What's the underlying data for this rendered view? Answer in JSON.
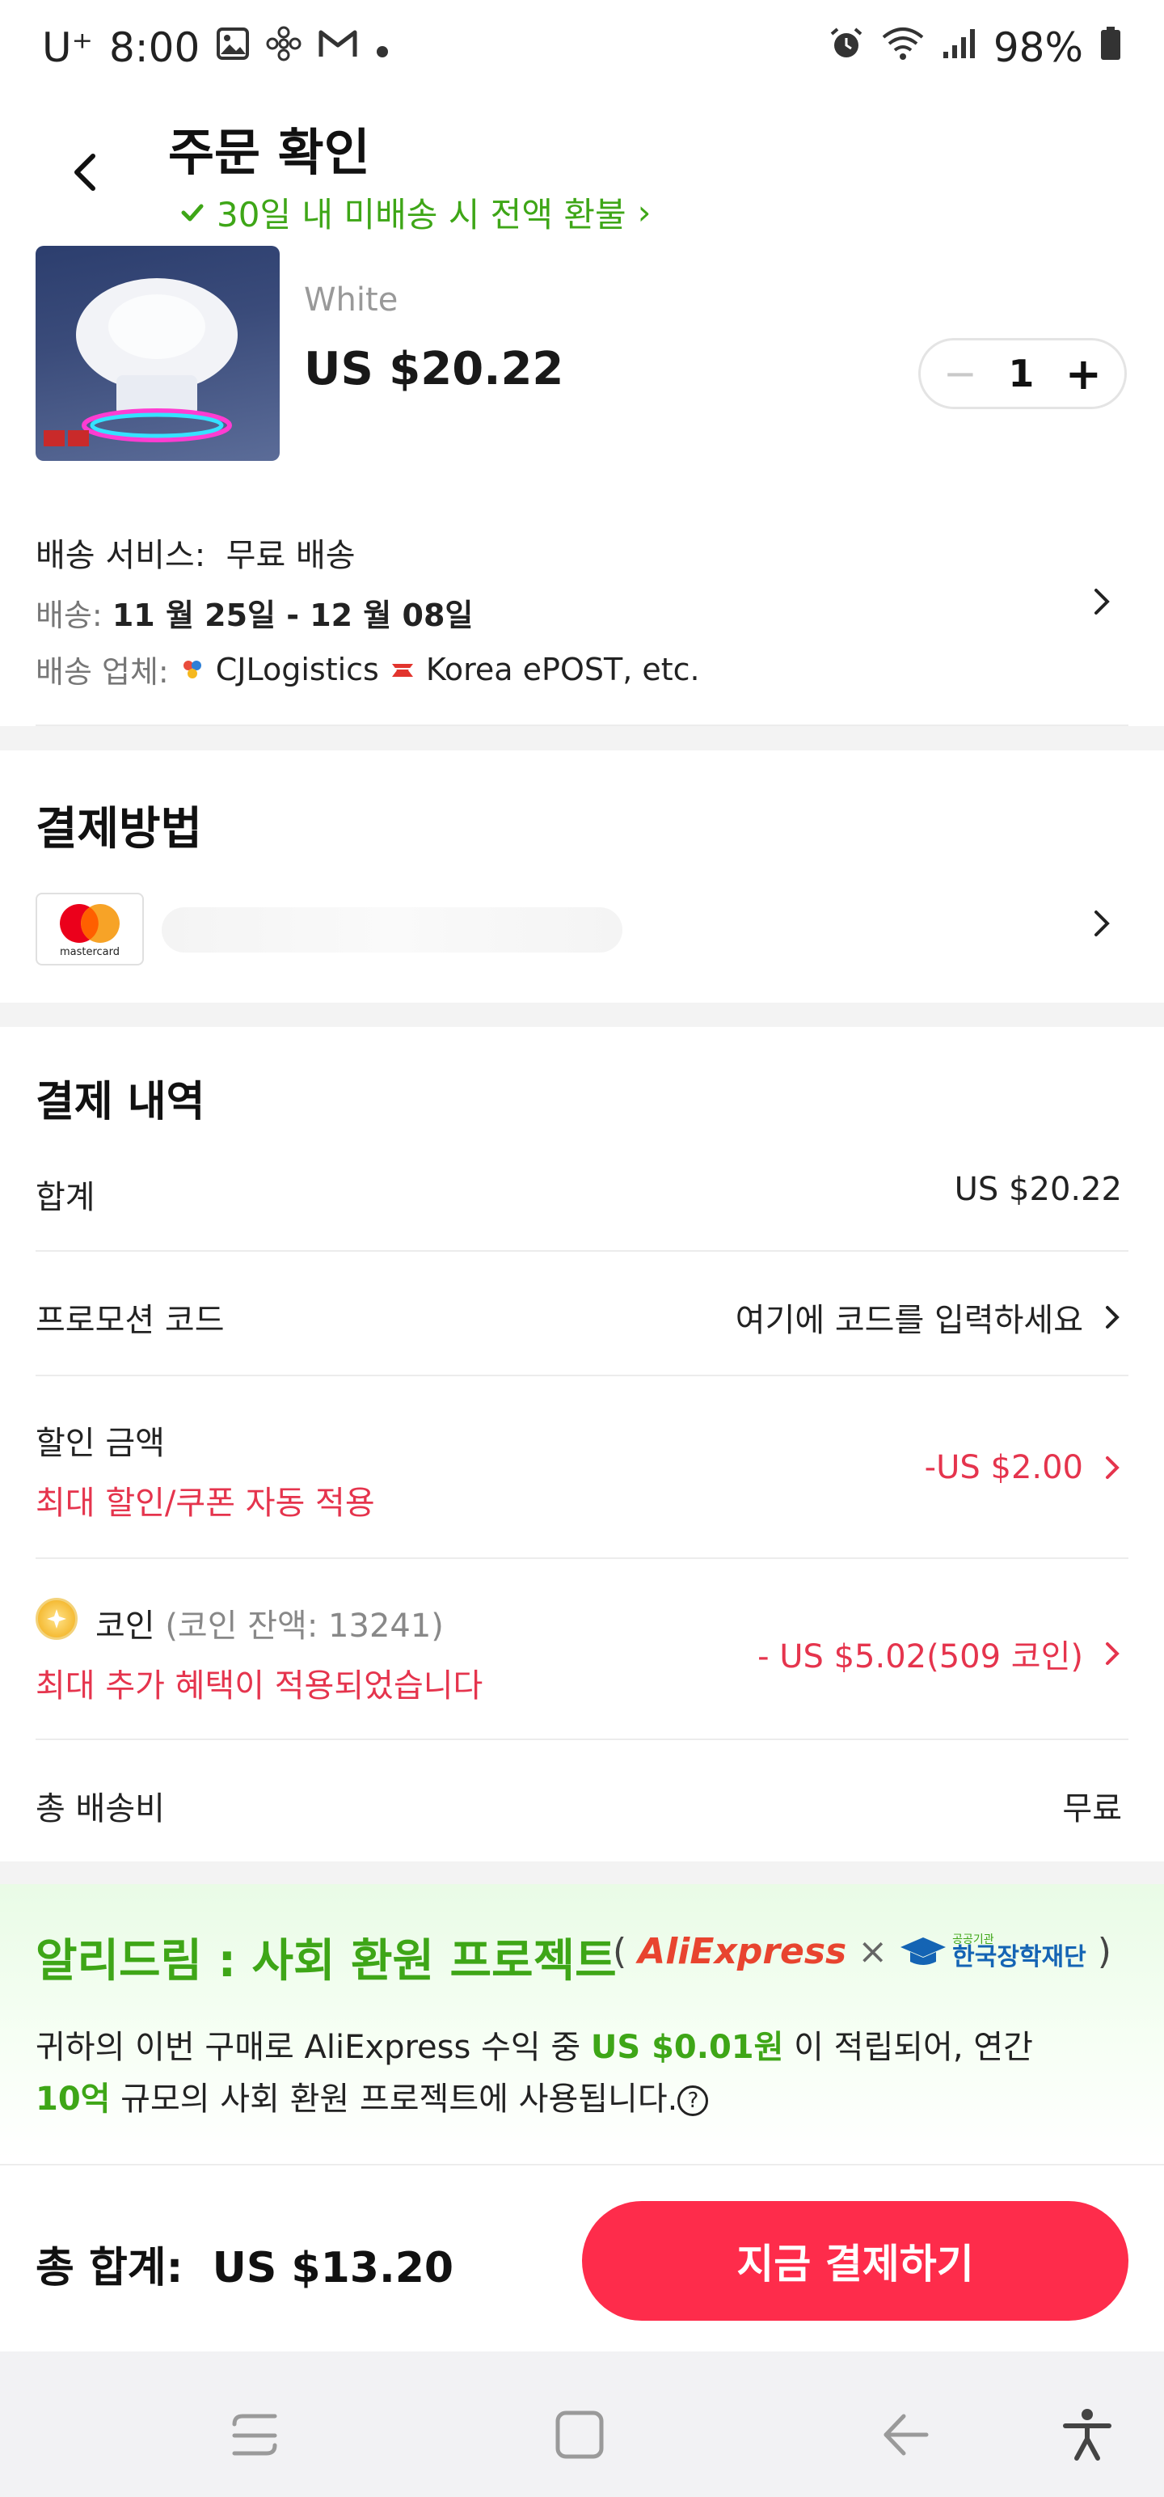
{
  "status_bar": {
    "carrier": "U⁺",
    "time": "8:00",
    "battery": "98%",
    "left_icons": [
      "gallery-icon",
      "fan-icon",
      "gmail-icon",
      "dot-icon"
    ],
    "right_icons": [
      "alarm-icon",
      "wifi-icon",
      "signal-icon",
      "battery-icon"
    ]
  },
  "header": {
    "title": "주문 확인",
    "refund_notice": "30일 내 미배송 시 전액 환불",
    "refund_chevron": "›",
    "accent_green": "#3ea617"
  },
  "product": {
    "variant": "White",
    "price": "US $20.22",
    "quantity": "1",
    "minus": "−",
    "plus": "+"
  },
  "shipping": {
    "service_label": "배송 서비스:",
    "service_value": "무료 배송",
    "date_label": "배송:",
    "date_value": "11 월 25일 - 12 월 08일",
    "carrier_label": "배송 업체:",
    "carrier_1": "CJLogistics",
    "carrier_2": "Korea ePOST, etc."
  },
  "payment_method": {
    "title": "결제방법",
    "card_brand": "mastercard"
  },
  "payment_details": {
    "title": "결제 내역",
    "subtotal_label": "합계",
    "subtotal_value": "US $20.22",
    "promo_label": "프로모션 코드",
    "promo_value": "여기에 코드를 입력하세요",
    "discount_label": "할인 금액",
    "discount_sub": "최대 할인/쿠폰 자동 적용",
    "discount_value": "-US $2.00",
    "coin_label": "코인",
    "coin_balance": "(코인 잔액: 13241)",
    "coin_sub": "최대 추가 혜택이 적용되었습니다",
    "coin_value": "- US $5.02(509 코인)",
    "shipping_label": "총 배송비",
    "shipping_value": "무료",
    "red_color": "#e5344d"
  },
  "ali_dream": {
    "title": "알리드림 : 사회 환원 프로젝트",
    "partner_open": "(",
    "partner_1": "AliExpress",
    "partner_x": "×",
    "partner_2": "한국장학재단",
    "partner_2_small": "공공기관",
    "partner_close": ")",
    "desc_1": "귀하의 이번 구매로 AliExpress 수익 중 ",
    "desc_amount": "US $0.01원",
    "desc_2": " 이 적립되어, 연간",
    "desc_scale": "10억",
    "desc_3": " 규모의 사회 환원 프로젝트에 사용됩니다.",
    "help": "?"
  },
  "checkout": {
    "total_label": "총 합계:",
    "total_value": "US $13.20",
    "pay_button": "지금 결제하기",
    "button_color": "#fe2c4b"
  },
  "nav_bar": {
    "items": [
      "recents-icon",
      "home-icon",
      "back-icon",
      "accessibility-icon"
    ]
  }
}
